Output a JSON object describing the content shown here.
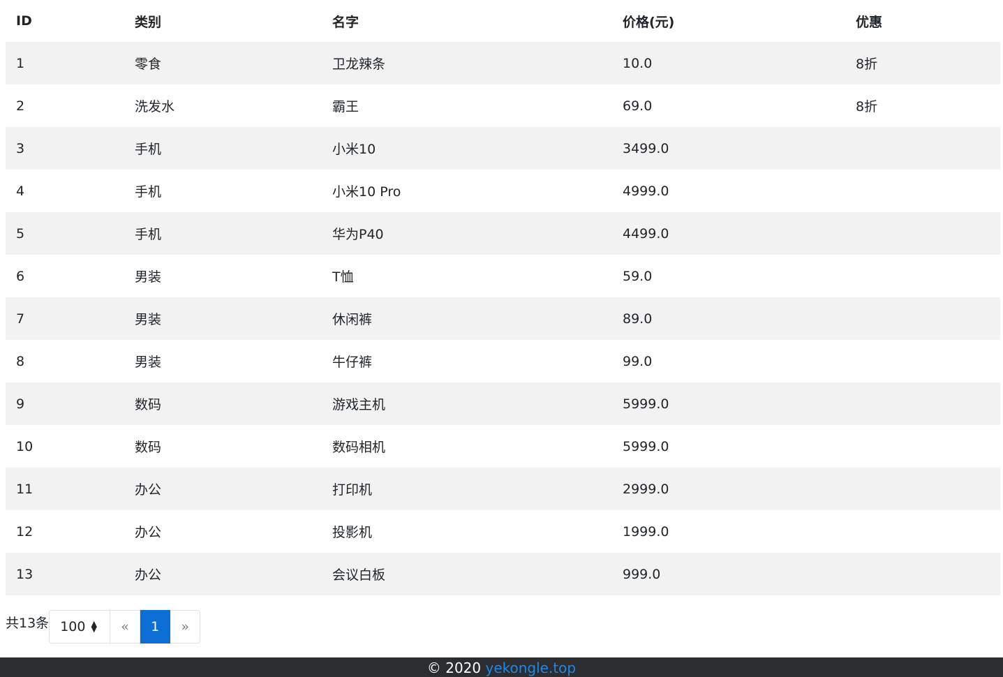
{
  "table": {
    "headers": [
      "ID",
      "类别",
      "名字",
      "价格(元)",
      "优惠"
    ],
    "rows": [
      [
        "1",
        "零食",
        "卫龙辣条",
        "10.0",
        "8折"
      ],
      [
        "2",
        "洗发水",
        "霸王",
        "69.0",
        "8折"
      ],
      [
        "3",
        "手机",
        "小米10",
        "3499.0",
        ""
      ],
      [
        "4",
        "手机",
        "小米10 Pro",
        "4999.0",
        ""
      ],
      [
        "5",
        "手机",
        "华为P40",
        "4499.0",
        ""
      ],
      [
        "6",
        "男装",
        "T恤",
        "59.0",
        ""
      ],
      [
        "7",
        "男装",
        "休闲裤",
        "89.0",
        ""
      ],
      [
        "8",
        "男装",
        "牛仔裤",
        "99.0",
        ""
      ],
      [
        "9",
        "数码",
        "游戏主机",
        "5999.0",
        ""
      ],
      [
        "10",
        "数码",
        "数码相机",
        "5999.0",
        ""
      ],
      [
        "11",
        "办公",
        "打印机",
        "2999.0",
        ""
      ],
      [
        "12",
        "办公",
        "投影机",
        "1999.0",
        ""
      ],
      [
        "13",
        "办公",
        "会议白板",
        "999.0",
        ""
      ]
    ]
  },
  "pager": {
    "total_text": "共13条",
    "page_size": "100",
    "prev": "«",
    "current_page": "1",
    "next": "»"
  },
  "footer": {
    "copyright": "© 2020 ",
    "link_text": "yekongle.top"
  },
  "colors": {
    "accent": "#0b6fd6",
    "stripe": "#f2f2f2",
    "footer_bg": "#2b2d30"
  }
}
